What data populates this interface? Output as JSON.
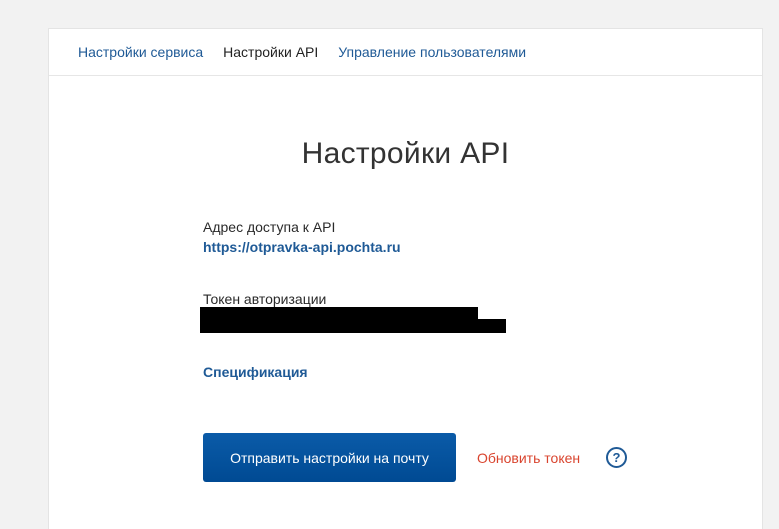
{
  "tabs": [
    {
      "label": "Настройки сервиса",
      "active": false
    },
    {
      "label": "Настройки API",
      "active": true
    },
    {
      "label": "Управление пользователями",
      "active": false
    }
  ],
  "main": {
    "title": "Настройки API",
    "api_address_label": "Адрес доступа к API",
    "api_address_url": "https://otpravka-api.pochta.ru",
    "token_label": "Токен авторизации",
    "specification_link": "Спецификация",
    "send_button_label": "Отправить настройки на почту",
    "refresh_token_label": "Обновить токен",
    "help_icon_glyph": "?"
  },
  "colors": {
    "link": "#1f5a96",
    "button": "#004a93",
    "danger_link": "#d9442e",
    "background": "#f2f2f2"
  }
}
